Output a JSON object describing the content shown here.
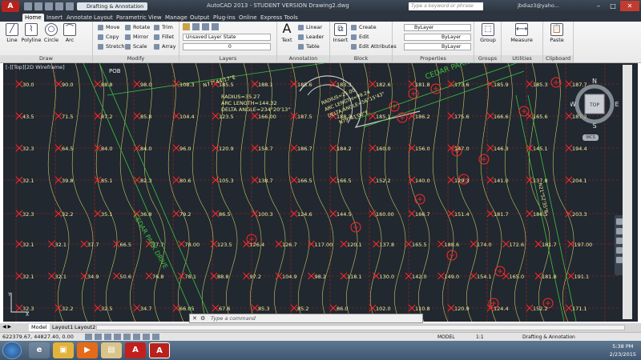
{
  "titlebar": {
    "app_logo": "A",
    "workspace": "Drafting & Annotation",
    "title": "AutoCAD 2013 - STUDENT VERSION     Drawing2.dwg",
    "search_placeholder": "Type a keyword or phrase",
    "user": "jbdiaz3@yaho..."
  },
  "tabs": [
    "Home",
    "Insert",
    "Annotate",
    "Layout",
    "Parametric",
    "View",
    "Manage",
    "Output",
    "Plug-ins",
    "Online",
    "Express Tools"
  ],
  "ribbon": {
    "draw": {
      "label": "Draw",
      "tools": [
        "Line",
        "Polyline",
        "Circle",
        "Arc"
      ]
    },
    "modify": {
      "label": "Modify",
      "items": [
        "Move",
        "Rotate",
        "Trim",
        "Copy",
        "Mirror",
        "Fillet",
        "Stretch",
        "Scale",
        "Array"
      ]
    },
    "layers": {
      "label": "Layers",
      "layer_state": "Unsaved Layer State",
      "current_layer": "0"
    },
    "annotation": {
      "label": "Annotation",
      "text": "Text",
      "items": [
        "Linear",
        "Leader",
        "Table"
      ]
    },
    "block": {
      "label": "Block",
      "insert": "Insert",
      "items": [
        "Create",
        "Edit",
        "Edit Attributes"
      ]
    },
    "properties": {
      "label": "Properties",
      "color": "ByLayer",
      "linetype": "ByLayer",
      "lineweight": "ByLayer"
    },
    "groups": {
      "label": "Groups",
      "group": "Group"
    },
    "utilities": {
      "label": "Utilities",
      "measure": "Measure"
    },
    "clipboard": {
      "label": "Clipboard",
      "paste": "Paste"
    }
  },
  "viewport": {
    "label": "[-][Top][2D Wireframe]",
    "viewcube": "TOP",
    "compass": {
      "n": "N",
      "s": "S",
      "e": "E",
      "w": "W"
    },
    "wcs": "WCS"
  },
  "annotations": {
    "pob": "POB",
    "bearing_top": "N77°44'17\"E",
    "radius": "RADIUS=35.27",
    "arc_length": "ARC LENGTH=144.32",
    "delta": "DELTA ANGLE=234°20'13\"",
    "arc2_radius": "RADIUS=25.00",
    "arc2_length": "ARC LENGTH=99.24",
    "arc2_delta": "DELTA ANGLE=56°15'43\"",
    "bearing2": "N79°41'08\"E",
    "cedar_park": "CEDAR PARK",
    "cedar_park_drive": "CEDAR PARK DRIVE",
    "right_bearing": "N21°52'35\"E"
  },
  "grid_values": [
    [
      "30.0",
      "90.0",
      "88.8",
      "98.0",
      "108.3",
      "185.5",
      "188.1",
      "185.6",
      "183.3",
      "182.6",
      "181.8",
      "173.6",
      "185.9",
      "185.3",
      "187.7"
    ],
    [
      "43.5",
      "71.5",
      "87.2",
      "85.8",
      "104.4",
      "123.5",
      "166.00",
      "187.5",
      "188.3",
      "185.1",
      "186.2",
      "175.6",
      "166.6",
      "165.6",
      "187.2"
    ],
    [
      "32.3",
      "64.5",
      "84.0",
      "84.0",
      "96.0",
      "120.9",
      "154.7",
      "186.7",
      "184.2",
      "160.0",
      "156.0",
      "147.0",
      "146.3",
      "145.1",
      "194.4"
    ],
    [
      "32.1",
      "39.8",
      "85.1",
      "82.3",
      "80.6",
      "105.3",
      "138.7",
      "166.5",
      "166.5",
      "152.2",
      "140.0",
      "129.3",
      "141.0",
      "137.8",
      "204.1"
    ],
    [
      "32.3",
      "32.2",
      "35.1",
      "36.8",
      "79.2",
      "86.5",
      "100.3",
      "124.6",
      "144.5",
      "160.00",
      "166.7",
      "151.4",
      "181.7",
      "186.5",
      "203.3"
    ],
    [
      "32.1",
      "32.1",
      "37.7",
      "66.5",
      "77.7",
      "78.00",
      "123.5",
      "126.4",
      "126.7",
      "117.00",
      "120.1",
      "137.8",
      "165.5",
      "188.6",
      "174.0",
      "172.6",
      "181.7",
      "197.00"
    ],
    [
      "32.1",
      "32.1",
      "34.9",
      "50.6",
      "76.8",
      "78.1",
      "88.8",
      "97.2",
      "104.9",
      "98.2",
      "118.1",
      "130.0",
      "142.0",
      "149.0",
      "154.1",
      "165.0",
      "181.8",
      "191.1"
    ],
    [
      "32.3",
      "32.2",
      "32.5",
      "34.7",
      "66.05",
      "67.6",
      "85.3",
      "85.2",
      "86.0",
      "102.0",
      "110.8",
      "120.9",
      "124.4",
      "152.2",
      "171.1"
    ]
  ],
  "command_placeholder": "Type a command",
  "layout_tabs": [
    "Model",
    "Layout1",
    "Layout2"
  ],
  "status": {
    "coords": "622379.67, 44827.40, 0.00",
    "model": "MODEL",
    "scale": "1:1",
    "workspace": "Drafting & Annotation"
  },
  "taskbar": {
    "time": "5:38 PM",
    "date": "2/23/2015"
  }
}
